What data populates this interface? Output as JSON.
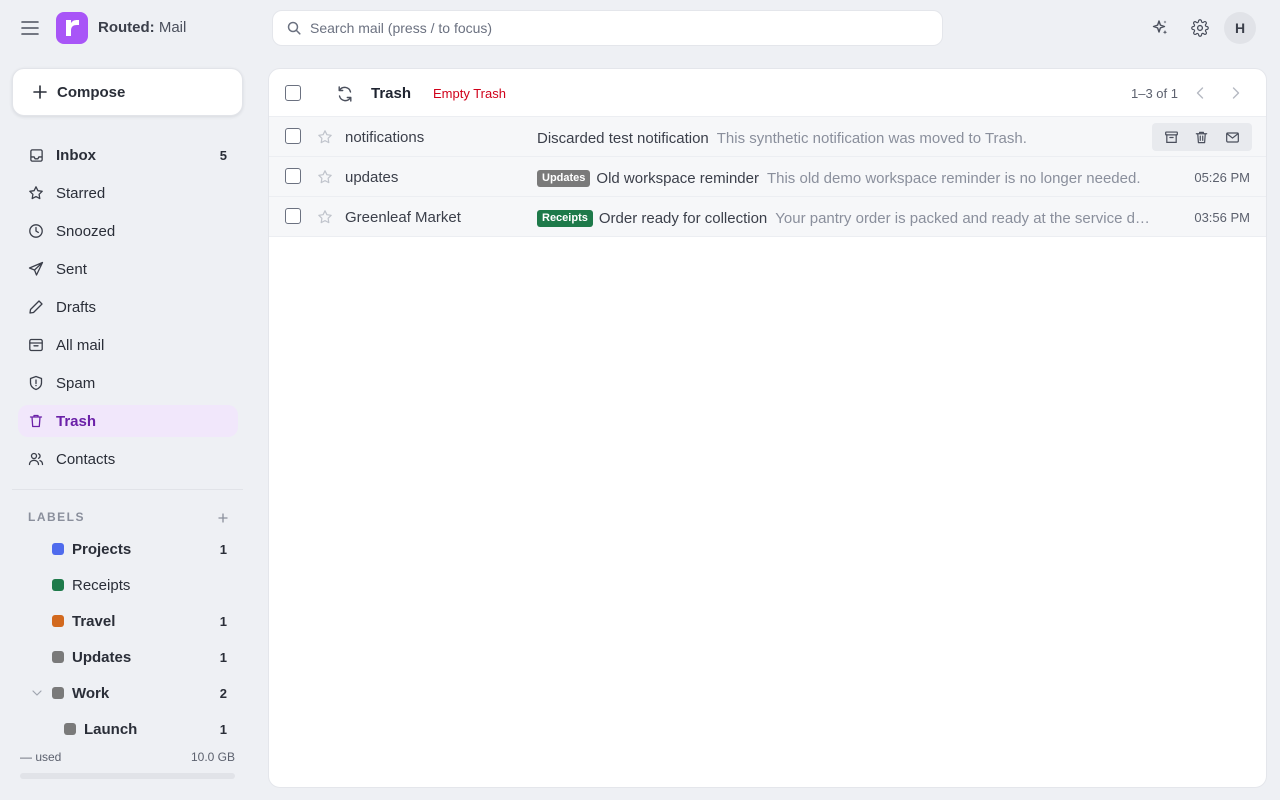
{
  "app": {
    "brand": "Routed:",
    "name": "Mail",
    "logo_letter": "r"
  },
  "search": {
    "placeholder": "Search mail  (press / to focus)"
  },
  "user": {
    "initial": "H"
  },
  "compose": {
    "label": "Compose"
  },
  "nav": [
    {
      "label": "Inbox",
      "count": "5",
      "icon": "inbox-icon",
      "bold": true
    },
    {
      "label": "Starred",
      "count": "",
      "icon": "star-icon"
    },
    {
      "label": "Snoozed",
      "count": "",
      "icon": "clock-icon"
    },
    {
      "label": "Sent",
      "count": "",
      "icon": "send-icon"
    },
    {
      "label": "Drafts",
      "count": "",
      "icon": "pencil-icon"
    },
    {
      "label": "All mail",
      "count": "",
      "icon": "archive-icon"
    },
    {
      "label": "Spam",
      "count": "",
      "icon": "shield-icon"
    },
    {
      "label": "Trash",
      "count": "",
      "icon": "trash-icon",
      "active": true
    },
    {
      "label": "Contacts",
      "count": "",
      "icon": "users-icon"
    }
  ],
  "labels": {
    "header": "LABELS",
    "items": [
      {
        "name": "Projects",
        "count": "1",
        "color": "#4f6bed"
      },
      {
        "name": "Receipts",
        "count": "",
        "color": "#1e7a4a"
      },
      {
        "name": "Travel",
        "count": "1",
        "color": "#d2691e"
      },
      {
        "name": "Updates",
        "count": "1",
        "color": "#7a7a7a"
      },
      {
        "name": "Work",
        "count": "2",
        "color": "#7a7a7a"
      },
      {
        "name": "Launch",
        "count": "1",
        "color": "#7a7a7a"
      }
    ]
  },
  "storage": {
    "used": "— used",
    "total": "10.0 GB",
    "fraction": 0
  },
  "toolbar": {
    "folder": "Trash",
    "empty_label": "Empty Trash",
    "pager": "1–3 of 1"
  },
  "messages": [
    {
      "sender": "notifications",
      "tag": "",
      "tag_color": "",
      "subject": "Discarded test notification",
      "snippet": "This synthetic notification was moved to Trash.",
      "time": ""
    },
    {
      "sender": "updates",
      "tag": "Updates",
      "tag_color": "#7a7a7a",
      "subject": "Old workspace reminder",
      "snippet": "This old demo workspace reminder is no longer needed.",
      "time": "05:26 PM"
    },
    {
      "sender": "Greenleaf Market",
      "tag": "Receipts",
      "tag_color": "#1e7a4a",
      "subject": "Order ready for collection",
      "snippet": "Your pantry order is packed and ready at the service desk for pickup.",
      "time": "03:56 PM"
    }
  ],
  "colors": {
    "brand": "#a855f7",
    "active_nav_bg": "#f1e7fb",
    "active_nav_text": "#6b21a8",
    "danger": "#d0021b"
  }
}
